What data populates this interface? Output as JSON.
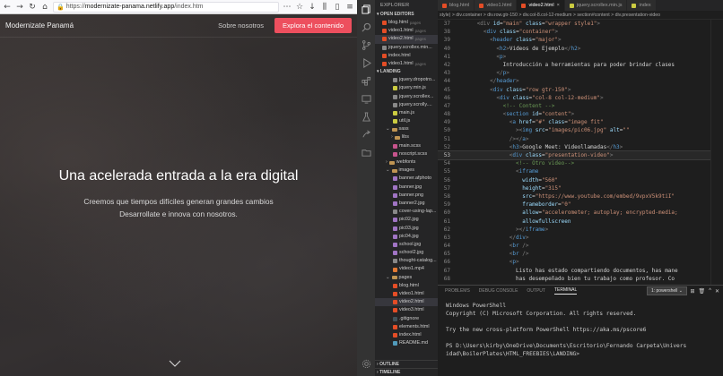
{
  "browser": {
    "url_prefix": "https://",
    "url_domain": "modernizate-panama.netlify.app",
    "url_suffix": "/index.htm"
  },
  "site": {
    "brand": "Modernizate Panamá",
    "nav_about": "Sobre nosotros",
    "nav_cta": "Explora el contenido",
    "hero_title": "Una acelerada entrada a la era digital",
    "hero_line1": "Creemos que tiempos difíciles generan grandes cambios",
    "hero_line2": "Desarrollate e innova con nosotros."
  },
  "explorer": {
    "title": "EXPLORER",
    "open_editors_label": "OPEN EDITORS",
    "open_editors": [
      {
        "name": "blog.html",
        "tag": "pages"
      },
      {
        "name": "video1.html",
        "tag": "pages"
      },
      {
        "name": "video2.html",
        "tag": "pages"
      },
      {
        "name": "jquery.scrollex.min...",
        "tag": ""
      },
      {
        "name": "index.html",
        "tag": ""
      },
      {
        "name": "video1.html",
        "tag": "pages"
      }
    ],
    "project_label": "LANDING",
    "files": [
      "jquery.dropotro...",
      "jquery.min.js",
      "jquery.scrollex...",
      "jquery.scrolly....",
      "main.js",
      "util.js",
      "sass",
      "libs",
      "main.scss",
      "noscript.scss",
      "webfonts",
      "images",
      "banner.afphoto",
      "banner.jpg",
      "banner.png",
      "banner2.jpg",
      "cover-using-lap...",
      "pic02.jpg",
      "pic03.jpg",
      "pic04.jpg",
      "school.jpg",
      "school2.jpg",
      "thought-catalog...",
      "video1.mp4",
      "pages",
      "blog.html",
      "video1.html",
      "video2.html",
      "video3.html",
      ".gitignore",
      "elements.html",
      "index.html",
      "README.md"
    ],
    "outline_label": "OUTLINE",
    "timeline_label": "TIMELINE"
  },
  "tabs": [
    {
      "label": "blog.html"
    },
    {
      "label": "video1.html"
    },
    {
      "label": "video2.html"
    },
    {
      "label": "jquery.scrollex.min.js"
    },
    {
      "label": "index"
    }
  ],
  "breadcrumb": "style) > div.container > div.row.gtr-150 > div.col-8.col-12-medium > section#content > div.presentation-video",
  "code": {
    "line_numbers": [
      "37",
      "38",
      "39",
      "40",
      "41",
      "42",
      "43",
      "44",
      "45",
      "46",
      "47",
      "48",
      "49",
      "50",
      "51",
      "52",
      "53",
      "54",
      "55",
      "56",
      "57",
      "58",
      "59",
      "60",
      "61",
      "62",
      "63",
      "64",
      "65",
      "66",
      "67",
      "68"
    ],
    "current_line": "53"
  },
  "terminal": {
    "tabs": [
      "PROBLEMS",
      "DEBUG CONSOLE",
      "OUTPUT",
      "TERMINAL"
    ],
    "active_tab": "TERMINAL",
    "shell_select": "1: powershell",
    "output": "Windows PowerShell\nCopyright (C) Microsoft Corporation. All rights reserved.\n\nTry the new cross-platform PowerShell https://aka.ms/pscore6\n\nPS D:\\Users\\kirby\\OneDrive\\Documents\\Escritorio\\Fernando Carpeta\\Univers\nidad\\BoilerPlates\\HTML_FREEBIES\\LANDING>"
  },
  "colors": {
    "accent_button": "#ed4f5e",
    "editor_bg": "#1e1e1e"
  }
}
